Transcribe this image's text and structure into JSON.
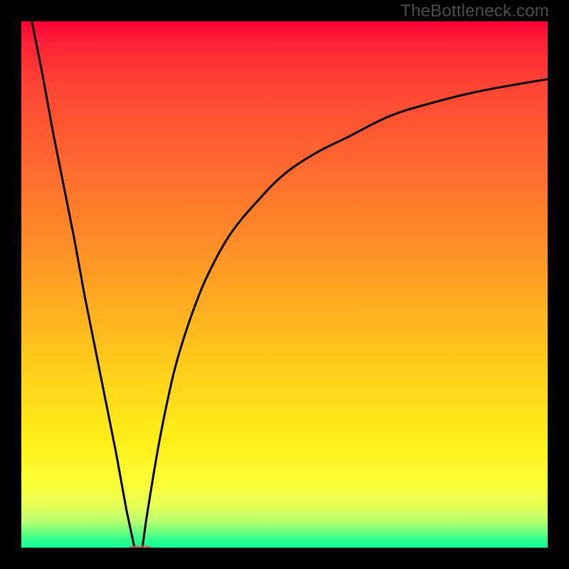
{
  "watermark": "TheBottleneck.com",
  "colors": {
    "curve_stroke": "#000000",
    "marker_fill": "#d45a5a",
    "frame_bg": "#000000"
  },
  "chart_data": {
    "type": "line",
    "title": "",
    "xlabel": "",
    "ylabel": "",
    "xlim": [
      0,
      100
    ],
    "ylim": [
      0,
      100
    ],
    "grid": false,
    "legend": false,
    "series": [
      {
        "name": "left-segment",
        "x": [
          2,
          4,
          6,
          8,
          10,
          12,
          14,
          16,
          18,
          20,
          21.5
        ],
        "y": [
          100,
          90,
          79,
          69,
          59,
          48,
          38,
          28,
          18,
          7,
          0
        ]
      },
      {
        "name": "right-segment",
        "x": [
          23,
          24,
          26,
          28,
          30,
          33,
          36,
          40,
          45,
          50,
          56,
          62,
          70,
          78,
          86,
          94,
          100
        ],
        "y": [
          0,
          7,
          19,
          29,
          37,
          46,
          53,
          60,
          66,
          71,
          75,
          78,
          82,
          84.5,
          86.5,
          88,
          89
        ]
      }
    ],
    "annotations": [
      {
        "name": "minimum-marker",
        "shape": "rounded-rect",
        "x": 22.5,
        "y": 0,
        "color": "#d45a5a"
      }
    ]
  }
}
